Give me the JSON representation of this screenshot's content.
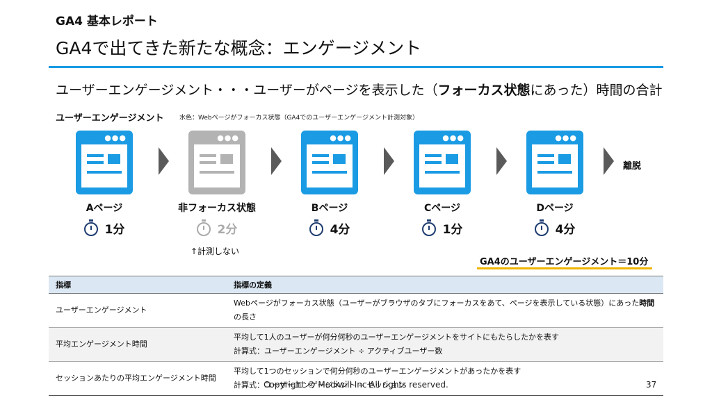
{
  "header": {
    "kicker": "GA4 基本レポート",
    "title": "GA4で出てきた新たな概念：エンゲージメント"
  },
  "subtitle": {
    "pre": "ユーザーエンゲージメント・・・ユーザーがページを表示した（",
    "bold": "フォーカス状態",
    "post": "にあった）時間の合計"
  },
  "section": {
    "label": "ユーザーエンゲージメント",
    "note": "水色：Webページがフォーカス状態（GA4でのユーザーエンゲージメント計測対象）"
  },
  "flow": {
    "pages": [
      {
        "label": "Aページ",
        "time": "1分",
        "state": "focus"
      },
      {
        "label": "非フォーカス状態",
        "time": "2分",
        "state": "unfocused"
      },
      {
        "label": "Bページ",
        "time": "4分",
        "state": "focus"
      },
      {
        "label": "Cページ",
        "time": "1分",
        "state": "focus"
      },
      {
        "label": "Dページ",
        "time": "4分",
        "state": "focus"
      }
    ],
    "exit_label": "離脱",
    "not_measured_note": "↑計測しない",
    "total": "GA4のユーザーエンゲージメント＝10分"
  },
  "colors": {
    "accent_blue": "#1a9be3",
    "unfocused_gray": "#b3b3b3",
    "highlight_yellow": "#f0b400",
    "header_row": "#dbe7f3"
  },
  "table": {
    "headers": [
      "指標",
      "指標の定義"
    ],
    "rows": [
      {
        "metric": "ユーザーエンゲージメント",
        "def_pre": "Webページがフォーカス状態（ユーザーがブラウザのタブにフォーカスをあて、ページを表示している状態）にあった",
        "def_bold": "時間",
        "def_post": "の長さ"
      },
      {
        "metric": "平均エンゲージメント時間",
        "line1": "平均して1人のユーザーが何分何秒のユーザーエンゲージメントをサイトにもたらしたかを表す",
        "line2": "計算式：ユーザーエンゲージメント ÷ アクティブユーザー数"
      },
      {
        "metric": "セッションあたりの平均エンゲージメント時間",
        "line1": "平均して1つのセッションで何分何秒のユーザーエンゲージメントがあったかを表す",
        "line2": "計算式：ユーザーエンゲージメント ÷ セッション"
      }
    ]
  },
  "footer": {
    "copyright": "Copyright © Mediwill Inc All rights reserved.",
    "page_number": "37"
  }
}
